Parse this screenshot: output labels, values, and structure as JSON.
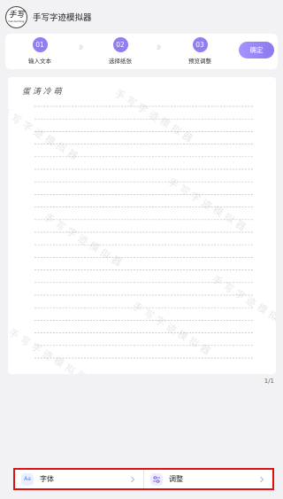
{
  "header": {
    "logo_text": "手写",
    "logo_subtext": "handwriting",
    "title": "手写字迹模拟器"
  },
  "steps": [
    {
      "number": "01",
      "label": "输入文本"
    },
    {
      "number": "02",
      "label": "选择纸张"
    },
    {
      "number": "03",
      "label": "预览调整"
    }
  ],
  "step_separator": "》》",
  "confirm_label": "确定",
  "paper": {
    "handwritten_text": "蛋 涛 冷 萌",
    "watermark_text": "手写字迹模拟器"
  },
  "page_counter": "1/1",
  "bottom_bar": {
    "font": {
      "icon_text": "Aa",
      "label": "字体"
    },
    "adjust": {
      "label": "调整"
    }
  },
  "colors": {
    "accent": "#8f7ff0",
    "highlight_border": "#e01010"
  }
}
